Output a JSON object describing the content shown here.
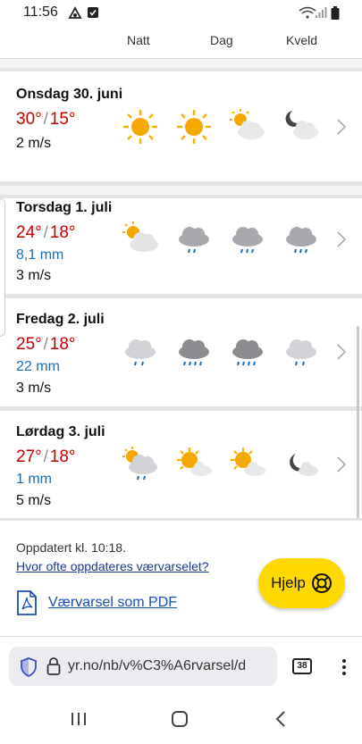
{
  "status_bar": {
    "time": "11:56"
  },
  "columns": {
    "night": "Natt",
    "day": "Dag",
    "evening": "Kveld"
  },
  "days": [
    {
      "name": "Onsdag 30. juni",
      "high": "30°",
      "low": "15°",
      "wind": "2 m/s",
      "precip": "",
      "icons": [
        "sun",
        "sun",
        "partly-cloudy-sun",
        "partly-cloudy-moon"
      ]
    },
    {
      "name": "Torsdag 1. juli",
      "high": "24°",
      "low": "18°",
      "precip": "8,1 mm",
      "wind": "3 m/s",
      "icons": [
        "partly-cloudy-sun",
        "cloud-rain",
        "cloud-rain",
        "cloud-rain"
      ]
    },
    {
      "name": "Fredag 2. juli",
      "high": "25°",
      "low": "18°",
      "precip": "22 mm",
      "wind": "3 m/s",
      "icons": [
        "cloud-light-rain",
        "cloud-heavy-rain",
        "cloud-heavy-rain",
        "cloud-light-rain"
      ]
    },
    {
      "name": "Lørdag 3. juli",
      "high": "27°",
      "low": "18°",
      "precip": "1 mm",
      "wind": "5 m/s",
      "icons": [
        "partly-cloudy-sun-rain",
        "partly-cloudy-sun",
        "partly-cloudy-sun",
        "partly-cloudy-moon"
      ]
    }
  ],
  "footer": {
    "updated": "Oppdatert kl. 10:18.",
    "update_link": "Hvor ofte oppdateres værvarselet?",
    "pdf_link": "Værvarsel som PDF",
    "help_label": "Hjelp"
  },
  "browser": {
    "url": "yr.no/nb/v%C3%A6rvarsel/d",
    "tab_count": "38"
  },
  "colors": {
    "temp_red": "#c60000",
    "precip_blue": "#1a6fb3",
    "help_yellow": "#ffd800"
  }
}
